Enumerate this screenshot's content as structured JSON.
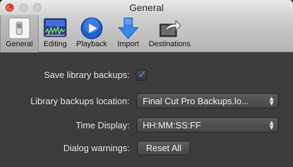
{
  "window": {
    "title": "General"
  },
  "toolbar": {
    "items": [
      {
        "label": "General",
        "icon": "switch-icon",
        "selected": true
      },
      {
        "label": "Editing",
        "icon": "waveform-icon",
        "selected": false
      },
      {
        "label": "Playback",
        "icon": "play-icon",
        "selected": false
      },
      {
        "label": "Import",
        "icon": "download-arrow-icon",
        "selected": false
      },
      {
        "label": "Destinations",
        "icon": "share-icon",
        "selected": false
      }
    ]
  },
  "settings": {
    "save_backups_label": "Save library backups:",
    "save_backups_checked": true,
    "backups_location_label": "Library backups location:",
    "backups_location_value": "Final Cut Pro Backups.lo...",
    "time_display_label": "Time Display:",
    "time_display_value": "HH:MM:SS:FF",
    "dialog_warnings_label": "Dialog warnings:",
    "reset_all_label": "Reset All"
  },
  "colors": {
    "accent": "#4d8ff0",
    "content_bg": "#3c3c3d",
    "toolbar_bg": "#c4c4c4"
  }
}
